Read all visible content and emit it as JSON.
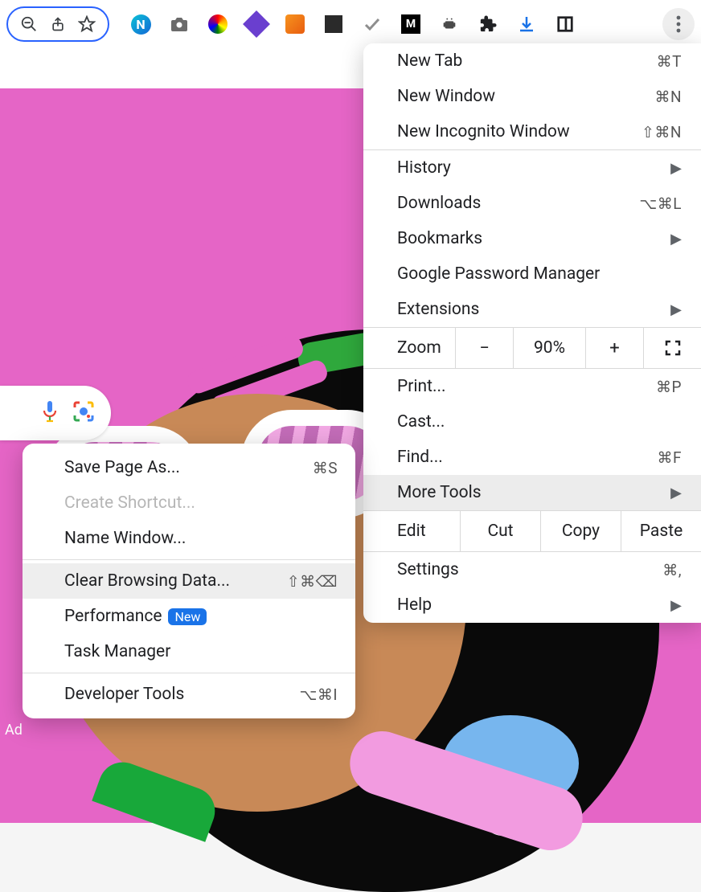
{
  "menu": {
    "new_tab": "New Tab",
    "new_tab_sc": "⌘T",
    "new_window": "New Window",
    "new_window_sc": "⌘N",
    "incognito": "New Incognito Window",
    "incognito_sc": "⇧⌘N",
    "history": "History",
    "downloads": "Downloads",
    "downloads_sc": "⌥⌘L",
    "bookmarks": "Bookmarks",
    "password_mgr": "Google Password Manager",
    "extensions": "Extensions",
    "zoom_label": "Zoom",
    "zoom_minus": "−",
    "zoom_value": "90%",
    "zoom_plus": "+",
    "print": "Print...",
    "print_sc": "⌘P",
    "cast": "Cast...",
    "find": "Find...",
    "find_sc": "⌘F",
    "more_tools": "More Tools",
    "edit": "Edit",
    "cut": "Cut",
    "copy": "Copy",
    "paste": "Paste",
    "settings": "Settings",
    "settings_sc": "⌘,",
    "help": "Help"
  },
  "submenu": {
    "save_page": "Save Page As...",
    "save_page_sc": "⌘S",
    "create_shortcut": "Create Shortcut...",
    "name_window": "Name Window...",
    "clear_data": "Clear Browsing Data...",
    "clear_data_sc": "⇧⌘⌫",
    "performance": "Performance",
    "perf_badge": "New",
    "task_manager": "Task Manager",
    "dev_tools": "Developer Tools",
    "dev_tools_sc": "⌥⌘I"
  },
  "page": {
    "ad_label": "Ad"
  }
}
